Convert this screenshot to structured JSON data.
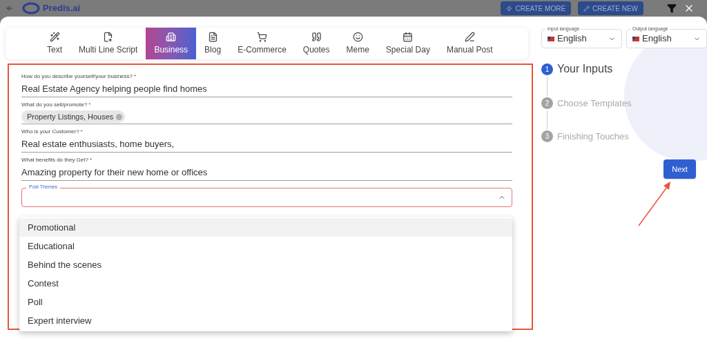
{
  "top_bar": {
    "logo_text": "Predis.ai",
    "buttons": [
      {
        "kind": "bolt",
        "label": "CREATE MORE"
      },
      {
        "kind": "pencil",
        "label": "CREATE NEW"
      }
    ]
  },
  "tabs": [
    {
      "kind": "wand",
      "label": "Text",
      "selected": false
    },
    {
      "kind": "script",
      "label": "Multi Line Script",
      "selected": false
    },
    {
      "kind": "building",
      "label": "Business",
      "selected": true
    },
    {
      "kind": "doc",
      "label": "Blog",
      "selected": false
    },
    {
      "kind": "cart",
      "label": "E-Commerce",
      "selected": false
    },
    {
      "kind": "quote",
      "label": "Quotes",
      "selected": false
    },
    {
      "kind": "smile",
      "label": "Meme",
      "selected": false
    },
    {
      "kind": "calendar",
      "label": "Special Day",
      "selected": false
    },
    {
      "kind": "pen",
      "label": "Manual Post",
      "selected": false
    }
  ],
  "form": {
    "fields": [
      {
        "kind": "text",
        "label": "How do you describe yourself/your business?",
        "required_mark": "*",
        "value": "Real Estate Agency helping people find homes"
      },
      {
        "kind": "chips",
        "label": "What do you sell/promote?",
        "required_mark": "*",
        "chips": [
          "Property Listings, Houses"
        ]
      },
      {
        "kind": "text",
        "label": "Who is your Customer?",
        "required_mark": "*",
        "value": "Real estate enthusiasts, home buyers,"
      },
      {
        "kind": "text",
        "label": "What benefits do they Get?",
        "required_mark": "*",
        "value": "Amazing property for their new home or offices"
      }
    ],
    "post_themes": {
      "label": "Post Themes",
      "expanded": true,
      "options": [
        {
          "label": "Promotional",
          "selected": true
        },
        {
          "label": "Educational",
          "selected": false
        },
        {
          "label": "Behind the scenes",
          "selected": false
        },
        {
          "label": "Contest",
          "selected": false
        },
        {
          "label": "Poll",
          "selected": false
        },
        {
          "label": "Expert interview",
          "selected": false
        }
      ]
    }
  },
  "languages": [
    {
      "label": "Input language",
      "value": "English"
    },
    {
      "label": "Output language",
      "value": "English"
    }
  ],
  "steps": [
    {
      "number": "1",
      "label": "Your Inputs",
      "selected": true
    },
    {
      "number": "2",
      "label": "Choose Templates",
      "selected": false
    },
    {
      "number": "3",
      "label": "Finishing Touches",
      "selected": false
    }
  ],
  "next_button": "Next"
}
